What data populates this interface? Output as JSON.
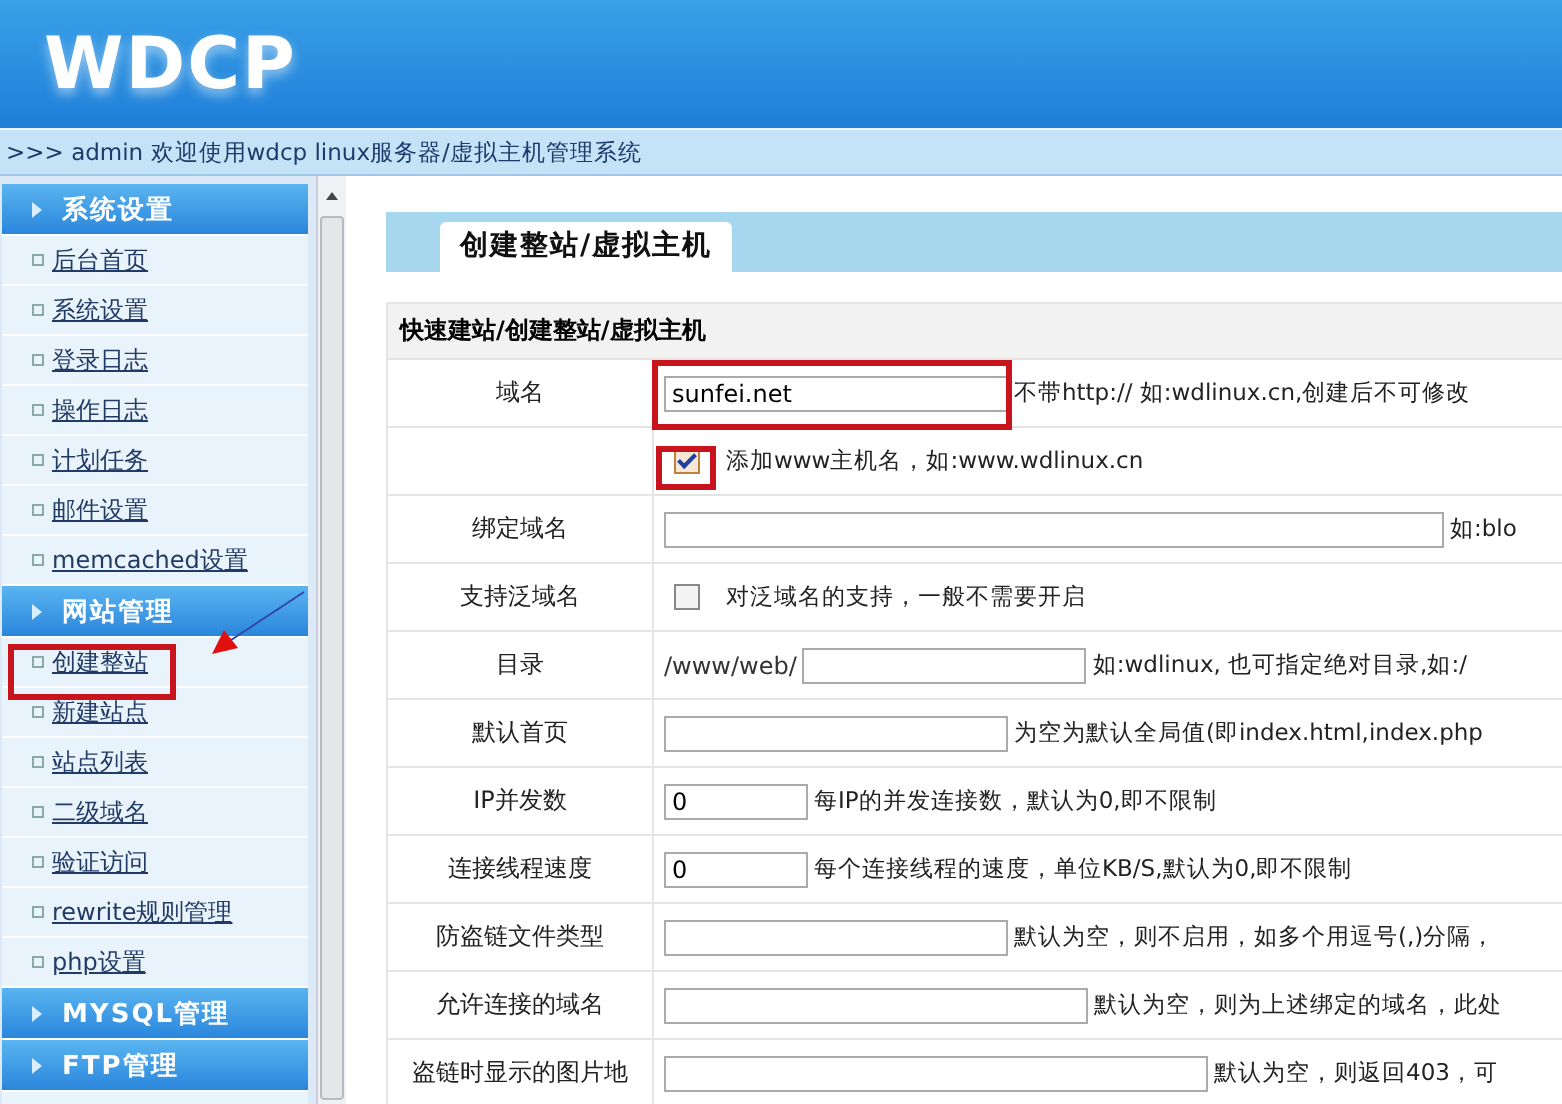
{
  "header": {
    "logo": "WDCP"
  },
  "breadcrumb": ">>> admin 欢迎使用wdcp linux服务器/虚拟主机管理系统",
  "sidebar": {
    "groups": [
      {
        "title": "系统设置",
        "items": [
          "后台首页",
          "系统设置",
          "登录日志",
          "操作日志",
          "计划任务",
          "邮件设置",
          "memcached设置"
        ]
      },
      {
        "title": "网站管理",
        "items": [
          "创建整站",
          "新建站点",
          "站点列表",
          "二级域名",
          "验证访问",
          "rewrite规则管理",
          "php设置"
        ]
      },
      {
        "title": "MYSQL管理"
      },
      {
        "title": "FTP管理"
      }
    ]
  },
  "tab": {
    "label": "创建整站/虚拟主机",
    "selected": true
  },
  "form": {
    "title": "快速建站/创建整站/虚拟主机",
    "rows": [
      {
        "kind": "input",
        "label": "域名",
        "value": "sunfei.net",
        "hint": "不带http:// 如:wdlinux.cn,创建后不可修改"
      },
      {
        "kind": "checkbox",
        "label": "",
        "checked": true,
        "hint": "添加www主机名，如:www.wdlinux.cn"
      },
      {
        "kind": "input",
        "label": "绑定域名",
        "value": "",
        "hint": "如:blo"
      },
      {
        "kind": "checkbox",
        "label": "支持泛域名",
        "checked": false,
        "hint": "对泛域名的支持，一般不需要开启"
      },
      {
        "kind": "prefixed",
        "label": "目录",
        "prefix": "/www/web/",
        "value": "",
        "hint": "如:wdlinux, 也可指定绝对目录,如:/"
      },
      {
        "kind": "input",
        "label": "默认首页",
        "value": "",
        "hint": "为空为默认全局值(即index.html,index.php"
      },
      {
        "kind": "input",
        "label": "IP并发数",
        "value": "0",
        "hint": "每IP的并发连接数，默认为0,即不限制"
      },
      {
        "kind": "input",
        "label": "连接线程速度",
        "value": "0",
        "hint": "每个连接线程的速度，单位KB/S,默认为0,即不限制"
      },
      {
        "kind": "input",
        "label": "防盗链文件类型",
        "value": "",
        "hint": "默认为空，则不启用，如多个用逗号(,)分隔，"
      },
      {
        "kind": "input",
        "label": "允许连接的域名",
        "value": "",
        "hint": "默认为空，则为上述绑定的域名，此处"
      },
      {
        "kind": "input",
        "label": "盗链时显示的图片地",
        "value": "",
        "hint": "默认为空，则返回403，可"
      }
    ]
  }
}
